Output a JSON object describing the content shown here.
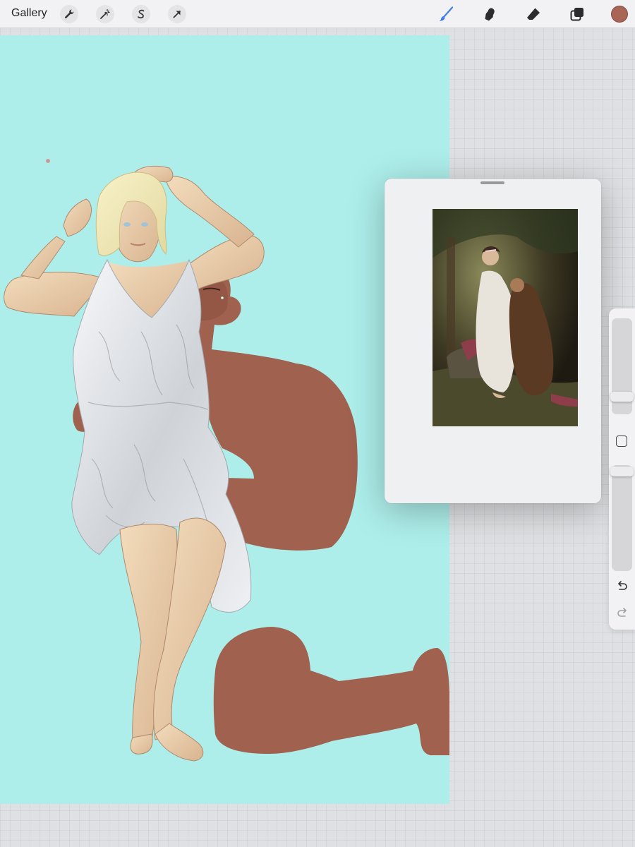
{
  "toolbar": {
    "gallery_label": "Gallery",
    "left_tools": [
      "wrench-icon",
      "magic-wand-icon",
      "selection-icon",
      "transform-arrow-icon"
    ],
    "right_tools": [
      "brush-icon",
      "smudge-icon",
      "eraser-icon",
      "layers-icon"
    ],
    "active_tool": "brush-icon",
    "accent_color": "#3d7ee8",
    "current_color": "#a96657"
  },
  "canvas": {
    "background_color": "#adeeea",
    "fill_color": "#a0614f"
  },
  "reference_window": {
    "background_color": "#eef0f1"
  },
  "sidebar": {
    "brush_size_level": 0.28,
    "opacity_level": 0.95,
    "icons": [
      "undo-icon",
      "redo-icon"
    ]
  }
}
